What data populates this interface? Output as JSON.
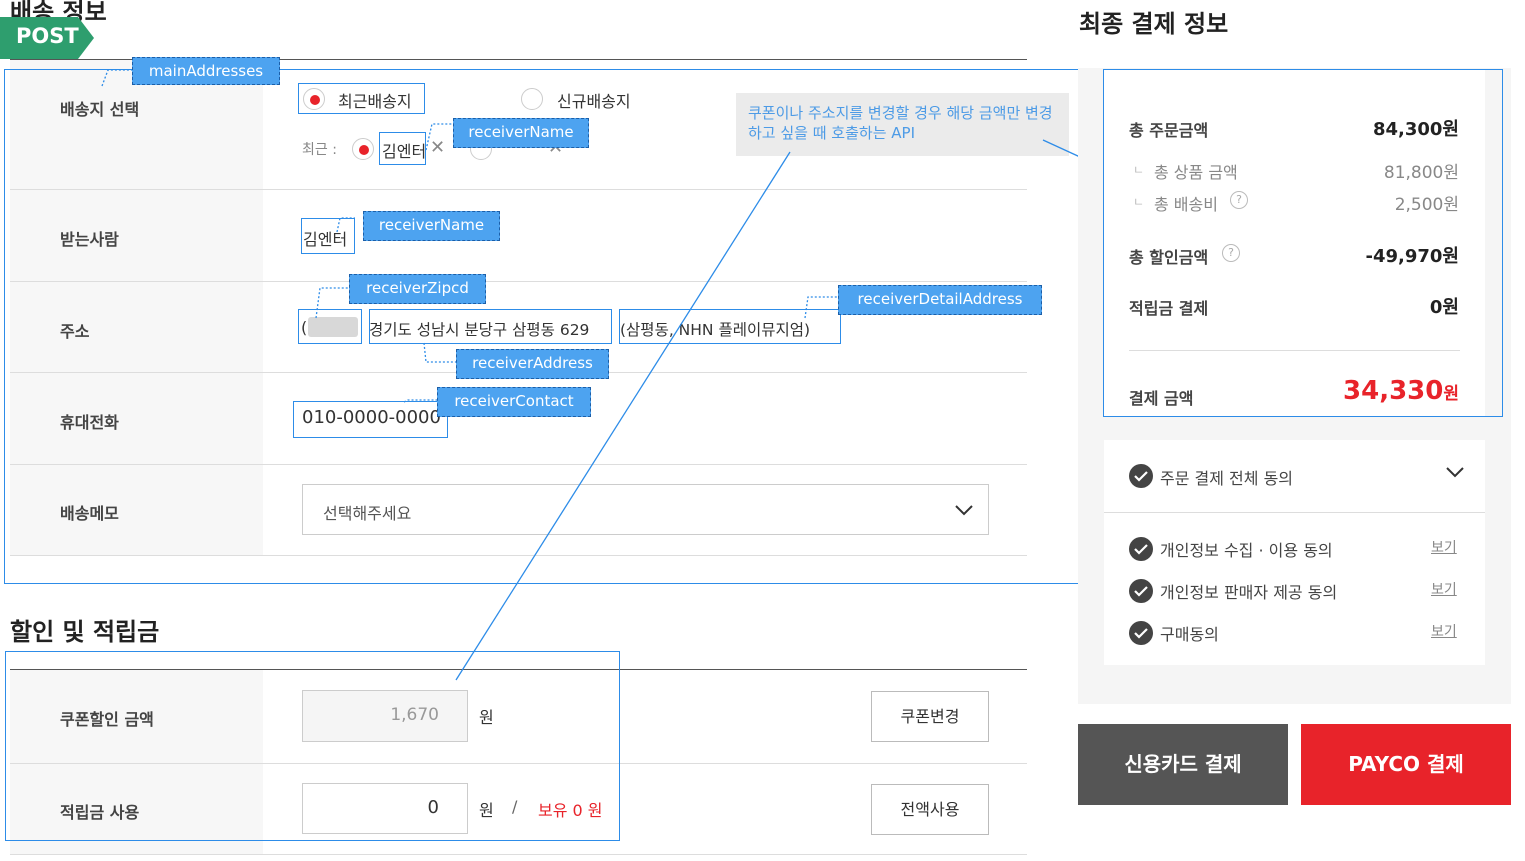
{
  "http_method": "POST",
  "delivery": {
    "title": "배송 정보",
    "rows": {
      "select_label": "배송지 선택",
      "receiver_label": "받는사람",
      "address_label": "주소",
      "phone_label": "휴대전화",
      "memo_label": "배송메모"
    },
    "radio_recent": "최근배송지",
    "radio_new": "신규배송지",
    "recent_prefix": "최근 :",
    "recent_name": "김엔터",
    "receiver_name": "김엔터",
    "address_main": "경기도 성남시 분당구 삼평동 629",
    "address_detail": "(삼평동, NHN 플레이뮤지엄)",
    "address_paren": "(",
    "phone": "010-0000-0000",
    "memo_placeholder": "선택해주세요"
  },
  "annotations": {
    "mainAddresses": "mainAddresses",
    "receiverName1": "receiverName",
    "receiverName2": "receiverName",
    "receiverZipcd": "receiverZipcd",
    "receiverDetailAddress": "receiverDetailAddress",
    "receiverAddress": "receiverAddress",
    "receiverContact": "receiverContact",
    "note": "쿠폰이나 주소지를 변경할 경우 해당 금액만 변경하고 싶을 때 호출하는 API"
  },
  "discount": {
    "title": "할인 및 적립금",
    "coupon_label": "쿠폰할인 금액",
    "coupon_value": "1,670",
    "won": "원",
    "coupon_button": "쿠폰변경",
    "points_label": "적립금 사용",
    "points_value": "0",
    "points_won": "원",
    "slash": "/",
    "points_owned": "보유 0 원",
    "points_button": "전액사용"
  },
  "payment": {
    "title": "최종 결제 정보",
    "total_order_label": "총 주문금액",
    "total_order_value": "84,300원",
    "product_label": "총 상품 금액",
    "product_value": "81,800원",
    "shipping_label": "총 배송비",
    "shipping_value": "2,500원",
    "discount_label": "총 할인금액",
    "discount_value": "-49,970원",
    "points_label": "적립금 결제",
    "points_value": "0원",
    "final_label": "결제 금액",
    "final_value": "34,330",
    "final_unit": "원"
  },
  "agreements": {
    "all": "주문 결제 전체 동의",
    "items": [
      {
        "label": "개인정보 수집 · 이용 동의",
        "link": "보기"
      },
      {
        "label": "개인정보 판매자 제공 동의",
        "link": "보기"
      },
      {
        "label": "구매동의",
        "link": "보기"
      }
    ]
  },
  "buttons": {
    "card": "신용카드 결제",
    "payco": "PAYCO 결제"
  },
  "colors": {
    "accent_red": "#e8232a",
    "annotation_blue": "#4da3f0",
    "post_green": "#2e9e6e",
    "card_button": "#555555"
  }
}
